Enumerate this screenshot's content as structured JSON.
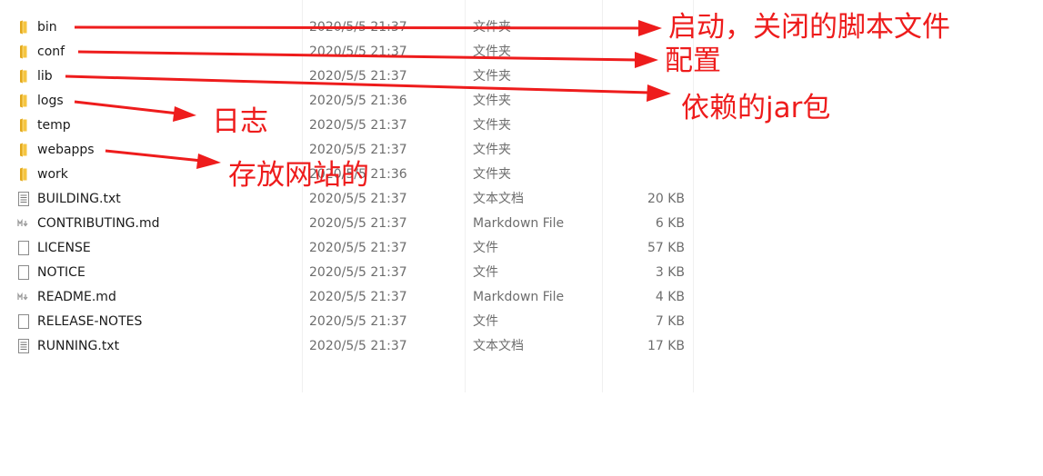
{
  "files": [
    {
      "name": "bin",
      "date": "2020/5/5 21:37",
      "type": "文件夹",
      "size": "",
      "icon": "folder-icon"
    },
    {
      "name": "conf",
      "date": "2020/5/5 21:37",
      "type": "文件夹",
      "size": "",
      "icon": "folder-icon"
    },
    {
      "name": "lib",
      "date": "2020/5/5 21:37",
      "type": "文件夹",
      "size": "",
      "icon": "folder-icon"
    },
    {
      "name": "logs",
      "date": "2020/5/5 21:36",
      "type": "文件夹",
      "size": "",
      "icon": "folder-icon"
    },
    {
      "name": "temp",
      "date": "2020/5/5 21:37",
      "type": "文件夹",
      "size": "",
      "icon": "folder-icon"
    },
    {
      "name": "webapps",
      "date": "2020/5/5 21:37",
      "type": "文件夹",
      "size": "",
      "icon": "folder-icon"
    },
    {
      "name": "work",
      "date": "2020/5/5 21:36",
      "type": "文件夹",
      "size": "",
      "icon": "folder-icon"
    },
    {
      "name": "BUILDING.txt",
      "date": "2020/5/5 21:37",
      "type": "文本文档",
      "size": "20 KB",
      "icon": "text-file-icon"
    },
    {
      "name": "CONTRIBUTING.md",
      "date": "2020/5/5 21:37",
      "type": "Markdown File",
      "size": "6 KB",
      "icon": "markdown-file-icon"
    },
    {
      "name": "LICENSE",
      "date": "2020/5/5 21:37",
      "type": "文件",
      "size": "57 KB",
      "icon": "blank-file-icon"
    },
    {
      "name": "NOTICE",
      "date": "2020/5/5 21:37",
      "type": "文件",
      "size": "3 KB",
      "icon": "blank-file-icon"
    },
    {
      "name": "README.md",
      "date": "2020/5/5 21:37",
      "type": "Markdown File",
      "size": "4 KB",
      "icon": "markdown-file-icon"
    },
    {
      "name": "RELEASE-NOTES",
      "date": "2020/5/5 21:37",
      "type": "文件",
      "size": "7 KB",
      "icon": "blank-file-icon"
    },
    {
      "name": "RUNNING.txt",
      "date": "2020/5/5 21:37",
      "type": "文本文档",
      "size": "17 KB",
      "icon": "text-file-icon"
    }
  ],
  "annotations": {
    "bin": "启动，关闭的脚本文件",
    "conf": "配置",
    "lib": "依赖的jar包",
    "logs": "日志",
    "webapps": "存放网站的"
  },
  "colors": {
    "annotation_red": "#ee1c1c",
    "folder_yellow": "#f5c542"
  }
}
